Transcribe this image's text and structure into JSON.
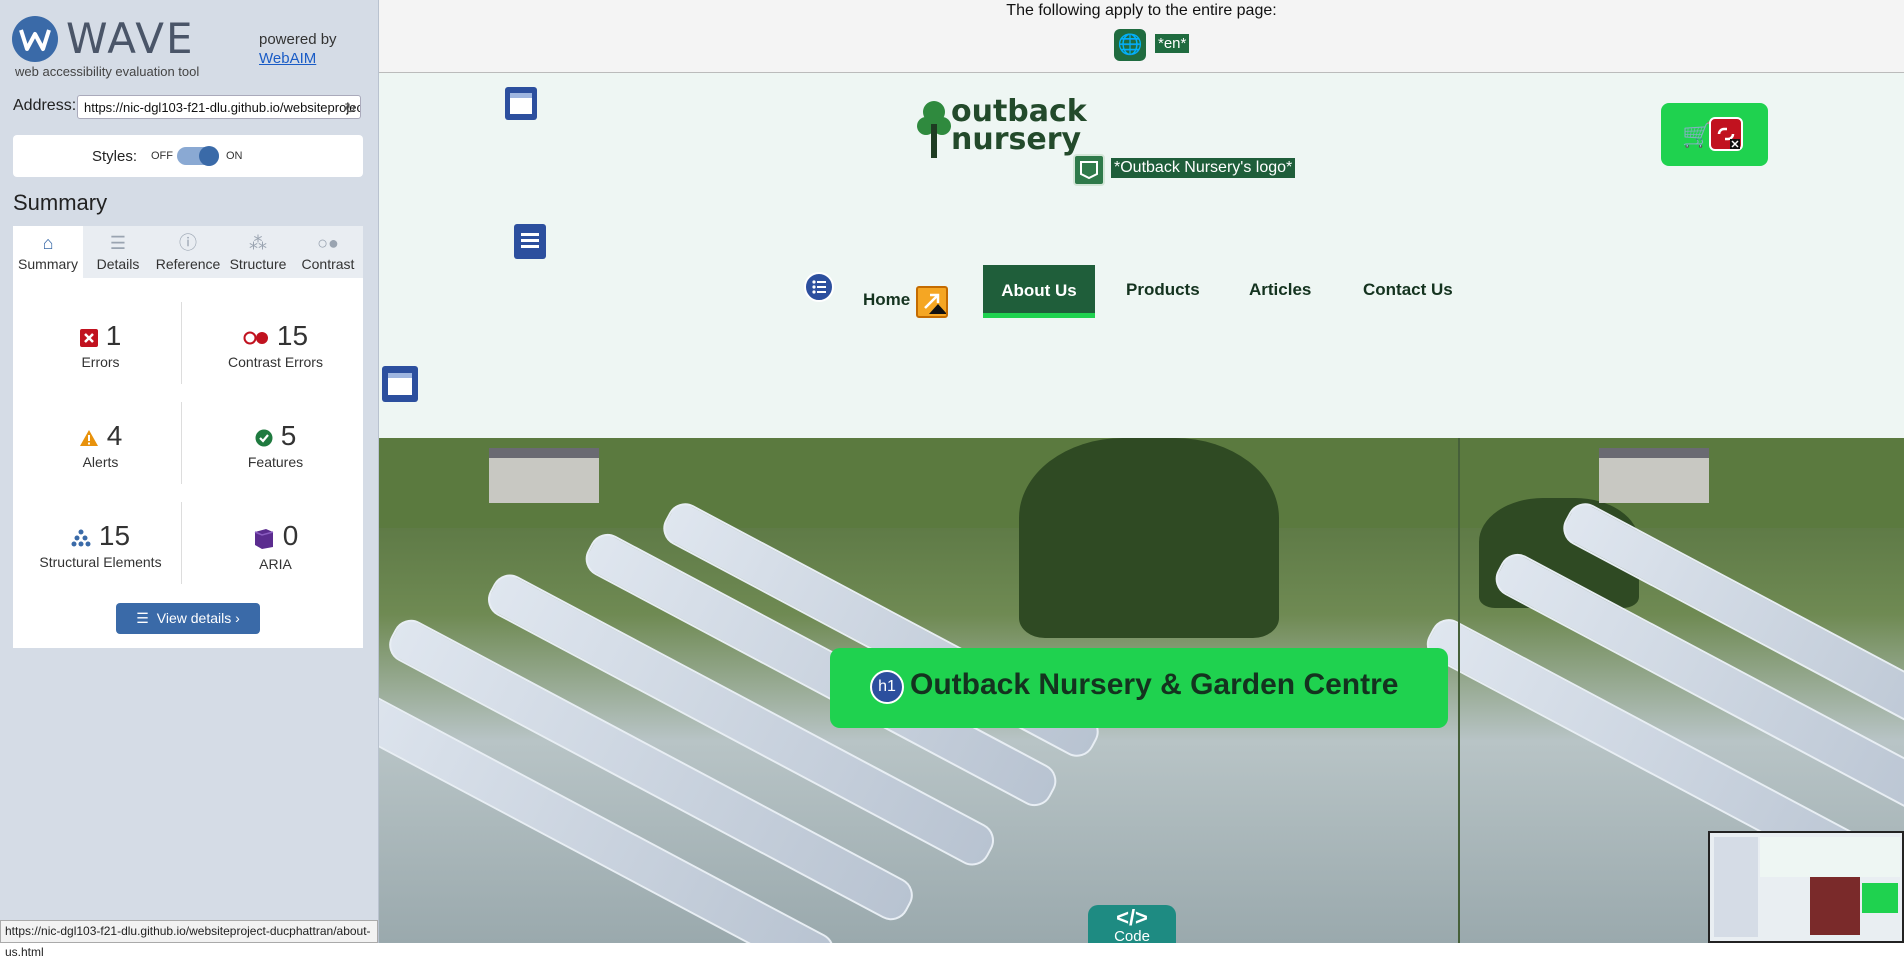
{
  "sidebar": {
    "logo": {
      "title": "WAVE",
      "subtitle": "web accessibility evaluation tool"
    },
    "powered_by": {
      "text": "powered by",
      "link": "WebAIM"
    },
    "address": {
      "label": "Address:",
      "value": "https://nic-dgl103-f21-dlu.github.io/websiteproject-ducphattran/about-us.html"
    },
    "styles": {
      "label": "Styles:",
      "off": "OFF",
      "on": "ON",
      "enabled": true
    },
    "summary_heading": "Summary",
    "tabs": [
      {
        "label": "Summary",
        "icon": "home-icon",
        "active": true
      },
      {
        "label": "Details",
        "icon": "list-icon"
      },
      {
        "label": "Reference",
        "icon": "info-icon"
      },
      {
        "label": "Structure",
        "icon": "structure-icon"
      },
      {
        "label": "Contrast",
        "icon": "contrast-icon"
      }
    ],
    "stats": {
      "errors": {
        "count": "1",
        "label": "Errors"
      },
      "contrast_errors": {
        "count": "15",
        "label": "Contrast Errors"
      },
      "alerts": {
        "count": "4",
        "label": "Alerts"
      },
      "features": {
        "count": "5",
        "label": "Features"
      },
      "structural": {
        "count": "15",
        "label": "Structural Elements"
      },
      "aria": {
        "count": "0",
        "label": "ARIA"
      }
    },
    "view_details": "View details ›",
    "status_url": "https://nic-dgl103-f21-dlu.github.io/websiteproject-ducphattran/about-us.html"
  },
  "page": {
    "applies_text": "The following apply to the entire page:",
    "lang_label": "*en*",
    "brand": {
      "line1": "outback",
      "line2": "nursery"
    },
    "logo_alt": "*Outback Nursery's logo*",
    "nav": [
      "Home",
      "About Us",
      "Products",
      "Articles",
      "Contact Us"
    ],
    "hero_heading": "Outback Nursery & Garden Centre",
    "h1_badge": "h1",
    "code_tab": {
      "symbol": "</>",
      "label": "Code"
    }
  },
  "colors": {
    "accent": "#1fd24f",
    "dark_green": "#1f5e3a",
    "wave_blue": "#3a6aa8",
    "error_red": "#c1121f"
  }
}
